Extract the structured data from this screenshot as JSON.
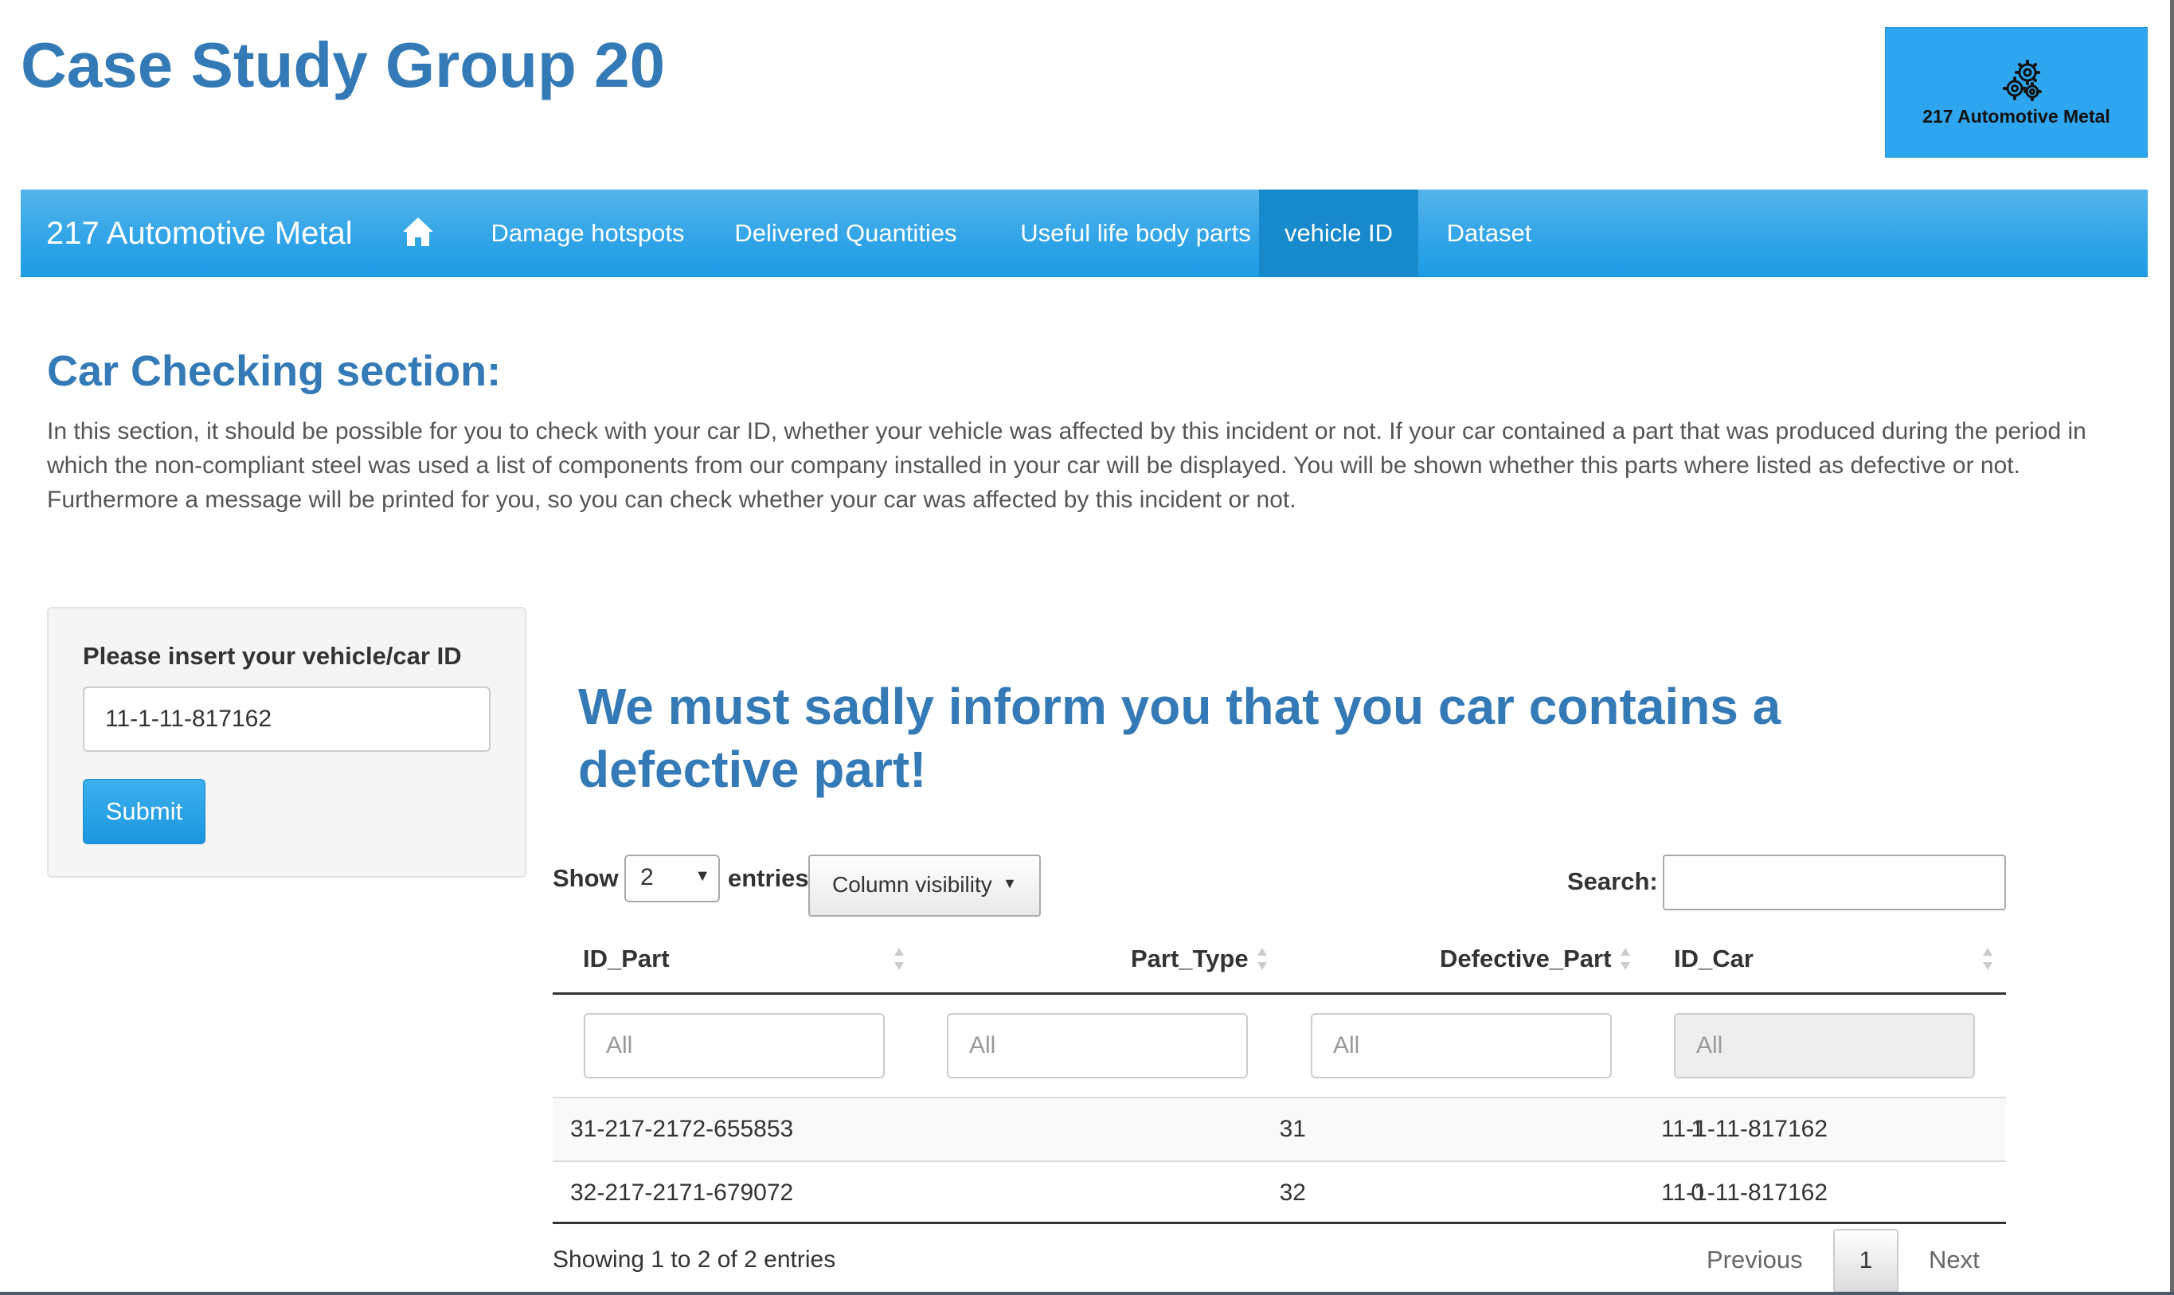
{
  "header": {
    "title": "Case Study Group 20",
    "logo_text": "217 Automotive Metal",
    "logo_icon": "gears-icon"
  },
  "navbar": {
    "brand": "217 Automotive Metal",
    "home_icon": "home-icon",
    "items": [
      {
        "label": "Damage hotspots",
        "active": false
      },
      {
        "label": "Delivered Quantities",
        "active": false
      },
      {
        "label": "Useful life body parts",
        "active": false
      },
      {
        "label": "vehicle ID",
        "active": true
      },
      {
        "label": "Dataset",
        "active": false
      }
    ]
  },
  "section": {
    "title": "Car Checking section:",
    "intro": "In this section, it should be possible for you to check with your car ID, whether your vehicle was affected by this incident or not. If your car contained a part that was produced during the period in which the non-compliant steel was used a list of components from our company installed in your car will be displayed. You will be shown whether this parts where listed as defective or not. Furthermore a message will be printed for you, so you can check whether your car was affected by this incident or not."
  },
  "form": {
    "label": "Please insert your vehicle/car ID",
    "vehicle_id": "11-1-11-817162",
    "submit_label": "Submit"
  },
  "result": {
    "message": "We must sadly inform you that you car contains a defective part!"
  },
  "table": {
    "show_label": "Show",
    "entries_label": "entries",
    "page_length": "2",
    "column_visibility_label": "Column visibility",
    "search_label": "Search:",
    "search_value": "",
    "columns": [
      "ID_Part",
      "Part_Type",
      "Defective_Part",
      "ID_Car"
    ],
    "filter_placeholder": "All",
    "rows": [
      [
        "31-217-2172-655853",
        "31",
        "1",
        "11-1-11-817162"
      ],
      [
        "32-217-2171-679072",
        "32",
        "0",
        "11-1-11-817162"
      ]
    ],
    "info": "Showing 1 to 2 of 2 entries",
    "pagination": {
      "previous": "Previous",
      "current": "1",
      "next": "Next"
    }
  },
  "colors": {
    "accent": "#337ab7",
    "navbar": "#2fa4e7",
    "navbar_active": "#178acc",
    "logo_background": "#2ea6ef"
  }
}
